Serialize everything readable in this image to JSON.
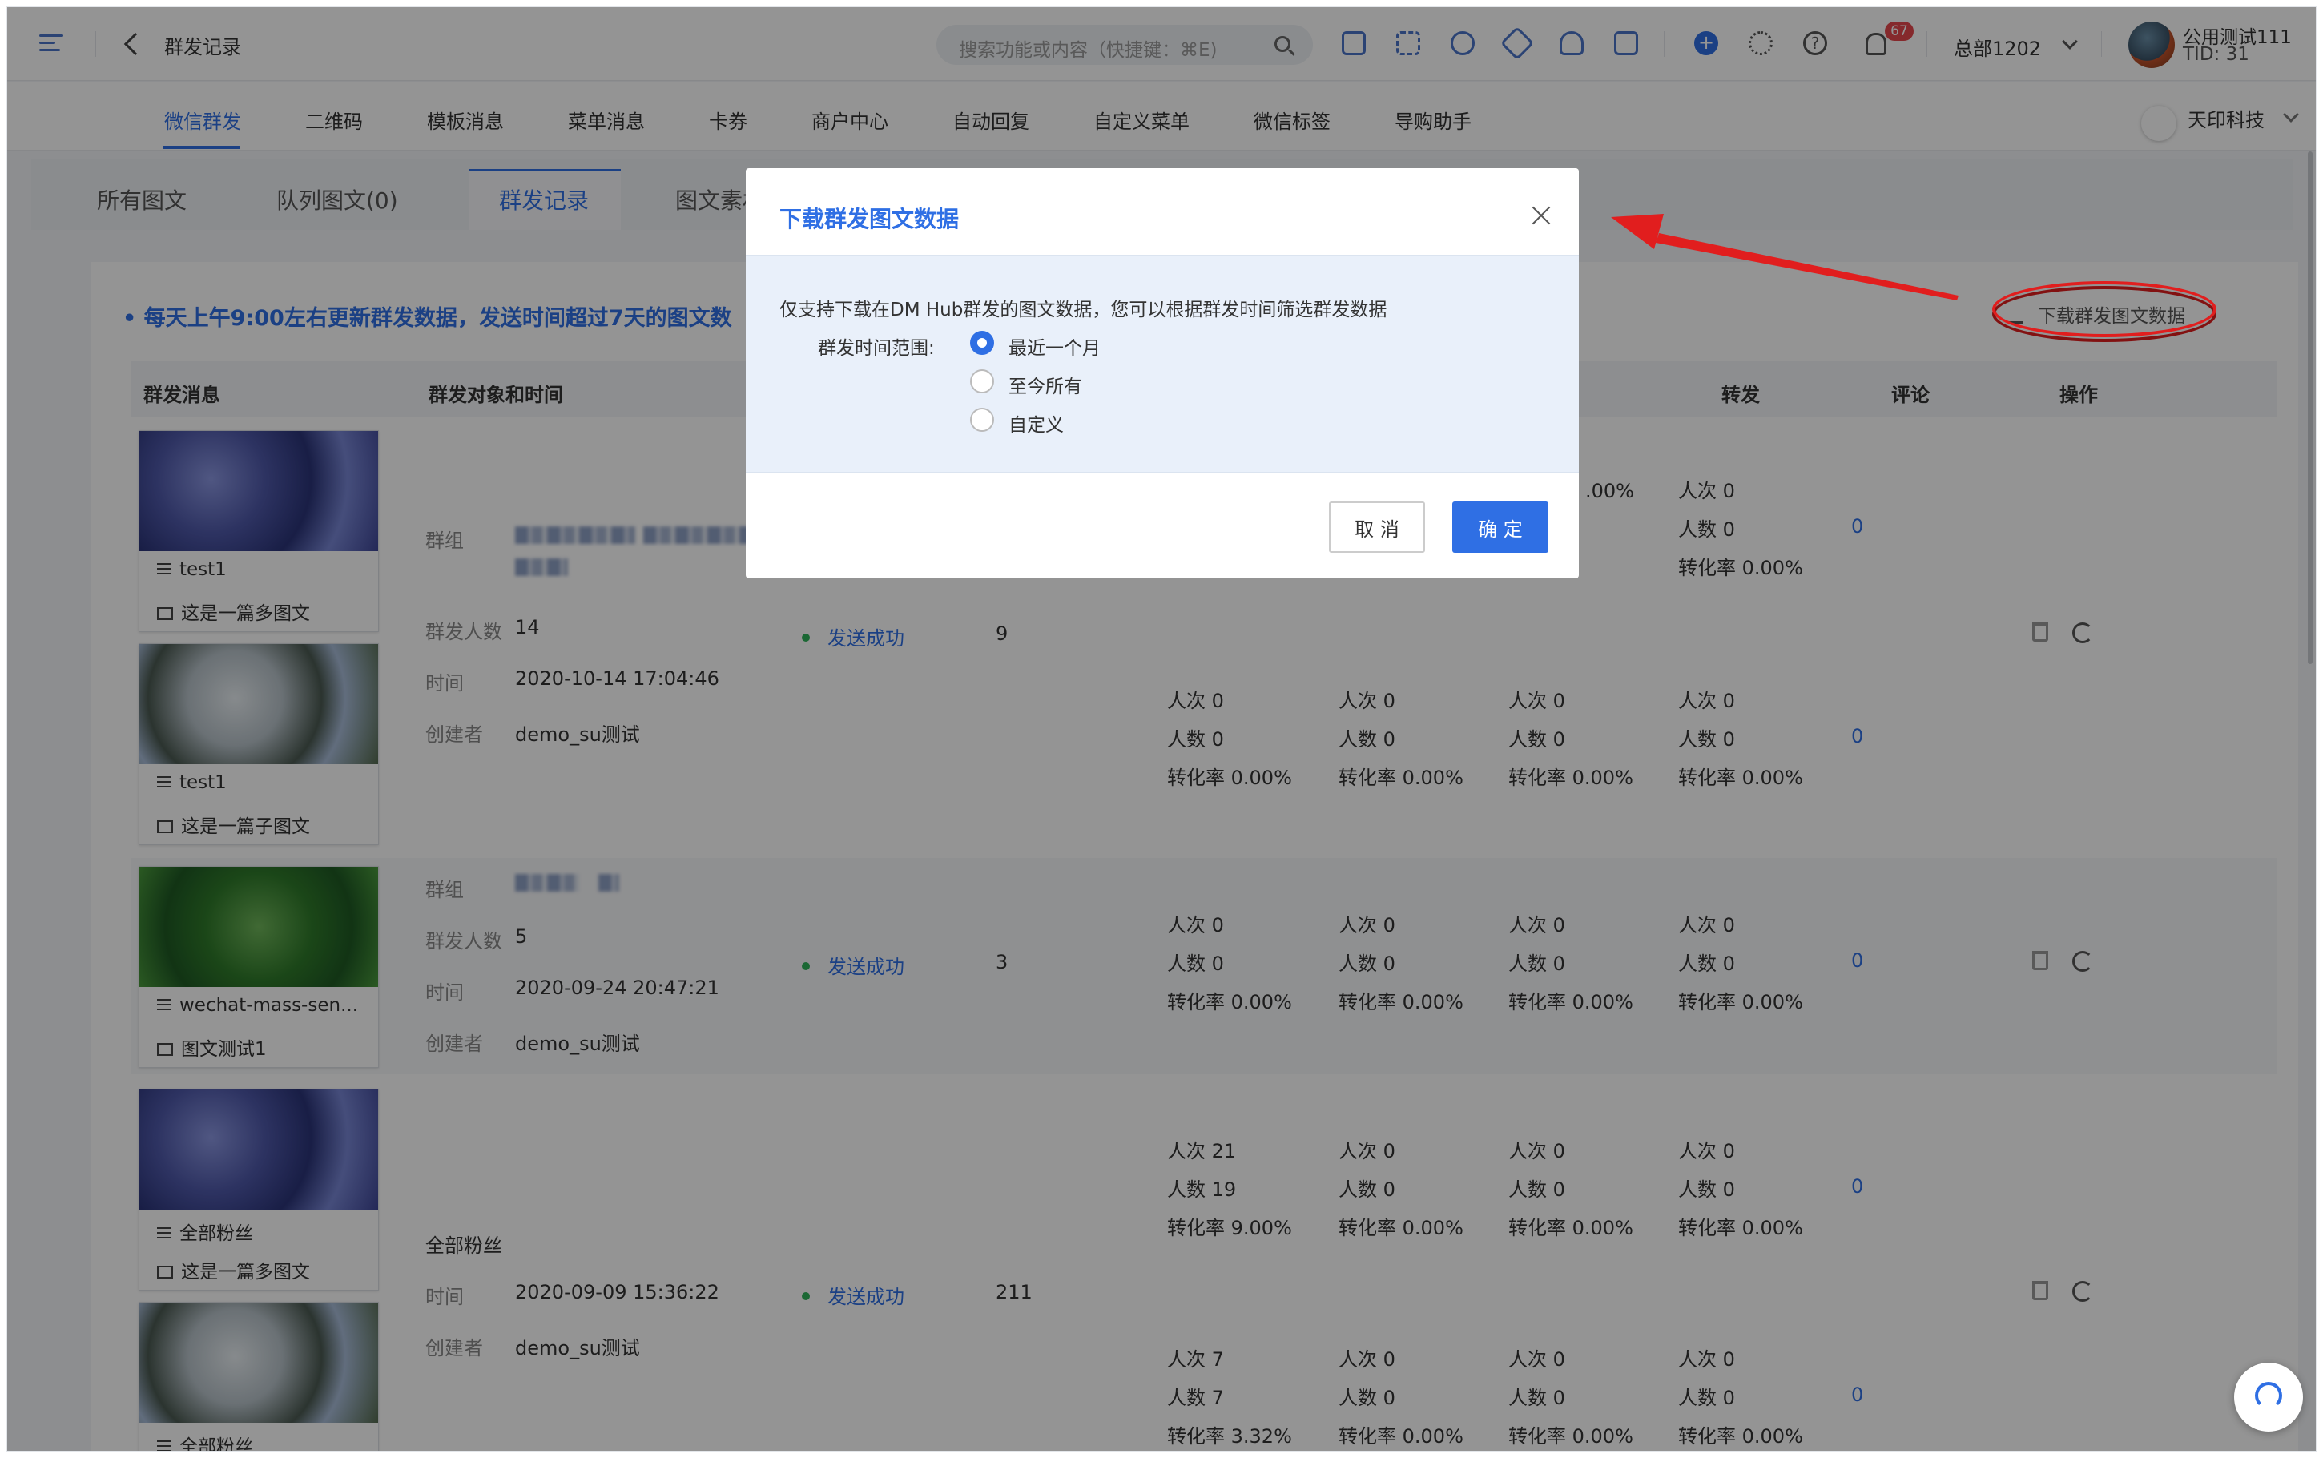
{
  "topbar": {
    "title": "群发记录",
    "search_placeholder": "搜索功能或内容（快捷键：⌘E)",
    "notification_count": "67",
    "org": "总部1202",
    "user_name": "公用测试111",
    "user_tid": "TID: 31",
    "icons": [
      "message-icon",
      "apps-icon",
      "compass-icon",
      "tag-icon",
      "users-icon",
      "calendar-icon",
      "plus-icon",
      "gear-icon",
      "help-icon",
      "bell-icon"
    ]
  },
  "nav": {
    "items": [
      "微信群发",
      "二维码",
      "模板消息",
      "菜单消息",
      "卡券",
      "商户中心",
      "自动回复",
      "自定义菜单",
      "微信标签",
      "导购助手"
    ],
    "active_index": 0,
    "brand": "天印科技"
  },
  "tabs": {
    "items": [
      "所有图文",
      "队列图文(0)",
      "群发记录",
      "图文素材"
    ],
    "active_index": 2
  },
  "content": {
    "notice": "• 每天上午9:00左右更新群发数据，发送时间超过7天的图文数",
    "download_link": "下载群发图文数据",
    "columns": {
      "msg": "群发消息",
      "target": "群发对象和时间",
      "forward": "转发",
      "comment": "评论",
      "action": "操作"
    },
    "labels": {
      "group": "群组",
      "count": "群发人数",
      "time": "时间",
      "creator": "创建者",
      "status": "发送成功"
    },
    "rows": [
      {
        "articles": [
          {
            "title": "test1",
            "subtitle": "这是一篇多图文",
            "image": "blue-hydrangea"
          },
          {
            "title": "test1",
            "subtitle": "这是一篇子图文",
            "image": "white-flowers"
          }
        ],
        "count": "14",
        "time": "2020-10-14 17:04:46",
        "creator": "demo_su测试",
        "sent": "9",
        "stats": [
          {
            "c1": [
              "",
              "",
              ".00%"
            ],
            "c4": [
              "人次 0",
              "人数 0",
              "转化率 0.00%"
            ],
            "comment": "0"
          },
          {
            "c1": [
              "人次 0",
              "人数 0",
              "转化率 0.00%"
            ],
            "c2": [
              "人次 0",
              "人数 0",
              "转化率 0.00%"
            ],
            "c3": [
              "人次 0",
              "人数 0",
              "转化率 0.00%"
            ],
            "c4": [
              "人次 0",
              "人数 0",
              "转化率 0.00%"
            ],
            "comment": "0"
          }
        ]
      },
      {
        "articles": [
          {
            "title": "wechat-mass-sen...",
            "subtitle": "图文测试1",
            "image": "green-plants"
          }
        ],
        "count": "5",
        "time": "2020-09-24 20:47:21",
        "creator": "demo_su测试",
        "sent": "3",
        "stats": [
          {
            "c1": [
              "人次 0",
              "人数 0",
              "转化率 0.00%"
            ],
            "c2": [
              "人次 0",
              "人数 0",
              "转化率 0.00%"
            ],
            "c3": [
              "人次 0",
              "人数 0",
              "转化率 0.00%"
            ],
            "c4": [
              "人次 0",
              "人数 0",
              "转化率 0.00%"
            ],
            "comment": "0"
          }
        ]
      },
      {
        "articles": [
          {
            "title": "全部粉丝",
            "subtitle": "这是一篇多图文",
            "image": "blue-hydrangea"
          },
          {
            "title": "全部粉丝",
            "subtitle": "",
            "image": "white-flowers"
          }
        ],
        "target": "全部粉丝",
        "time": "2020-09-09 15:36:22",
        "creator": "demo_su测试",
        "sent": "211",
        "stats": [
          {
            "c1": [
              "人次 21",
              "人数 19",
              "转化率 9.00%"
            ],
            "c2": [
              "人次 0",
              "人数 0",
              "转化率 0.00%"
            ],
            "c3": [
              "人次 0",
              "人数 0",
              "转化率 0.00%"
            ],
            "c4": [
              "人次 0",
              "人数 0",
              "转化率 0.00%"
            ],
            "comment": "0"
          },
          {
            "c1": [
              "人次 7",
              "人数 7",
              "转化率 3.32%"
            ],
            "c2": [
              "人次 0",
              "人数 0",
              "转化率 0.00%"
            ],
            "c3": [
              "人次 0",
              "人数 0",
              "转化率 0.00%"
            ],
            "c4": [
              "人次 0",
              "人数 0",
              "转化率 0.00%"
            ],
            "comment": "0"
          }
        ]
      }
    ]
  },
  "modal": {
    "title": "下载群发图文数据",
    "description": "仅支持下载在DM Hub群发的图文数据，您可以根据群发时间筛选群发数据",
    "range_label": "群发时间范围:",
    "options": [
      "最近一个月",
      "至今所有",
      "自定义"
    ],
    "selected_index": 0,
    "cancel": "取 消",
    "confirm": "确 定"
  },
  "colors": {
    "accent": "#2f6fe4",
    "annotation": "#e11e1e",
    "success_dot": "#2fb35a"
  }
}
